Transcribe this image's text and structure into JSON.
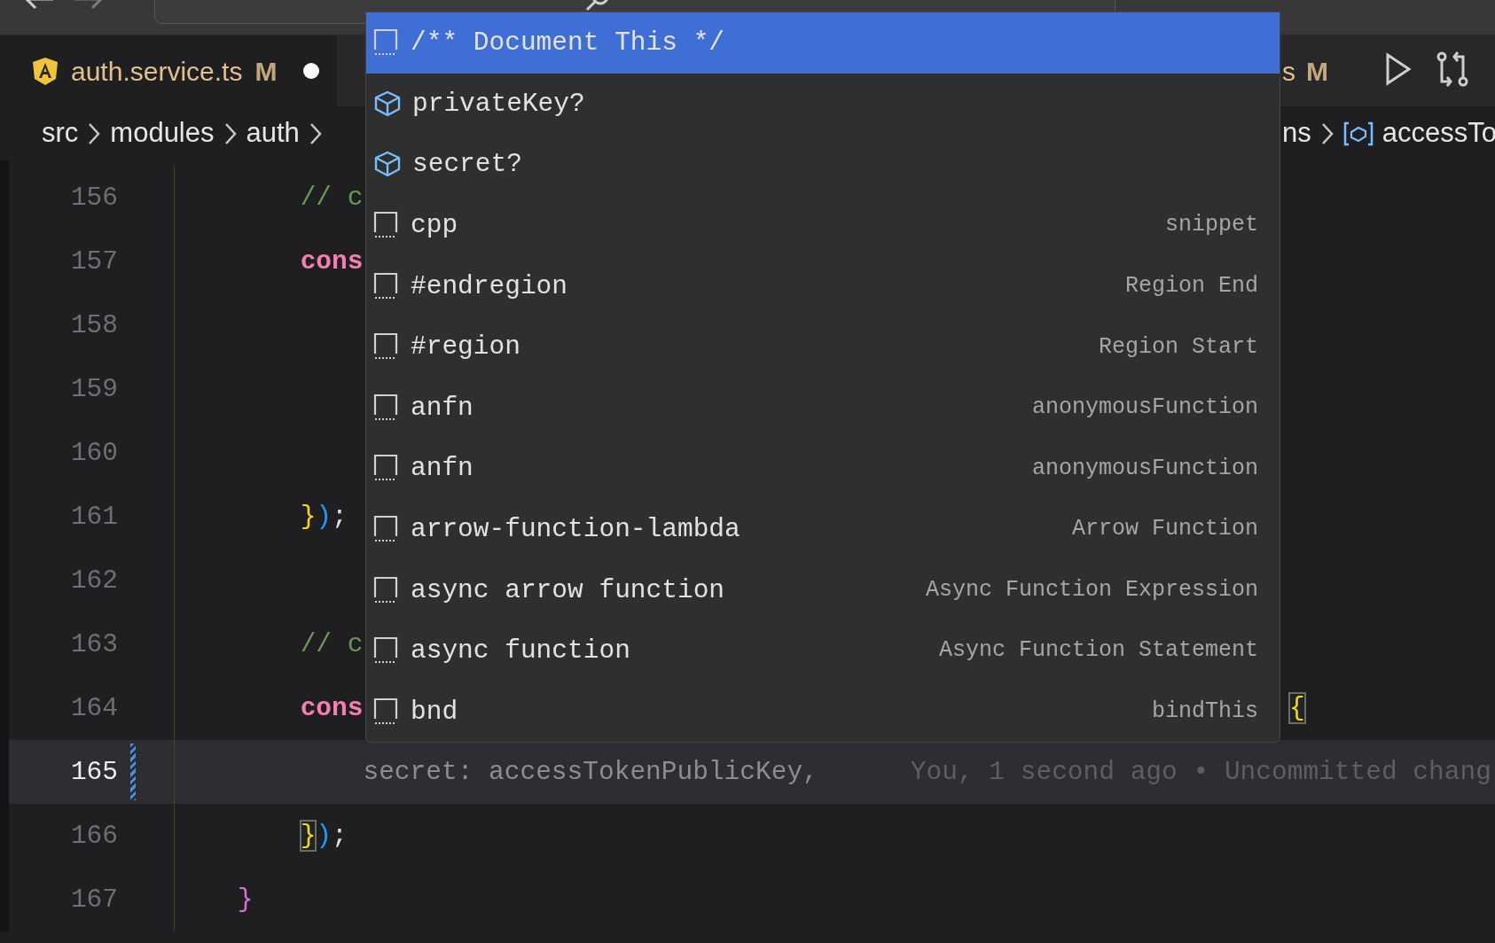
{
  "tabs": [
    {
      "kind": "angular",
      "filename": "auth.service.ts",
      "status": "M",
      "dirty": true
    },
    {
      "filename": "s",
      "status": "M",
      "dirty": false
    }
  ],
  "breadcrumbs": [
    {
      "label": "src"
    },
    {
      "label": "modules"
    },
    {
      "label": "auth"
    }
  ],
  "breadcrumbs_tail": [
    {
      "label": "ns"
    },
    {
      "label": "accessTo",
      "kind": "variable"
    }
  ],
  "editor": {
    "lines": [
      {
        "number": "156",
        "current": false,
        "changed": false,
        "tokens": [
          {
            "text": "        // c",
            "kind": "comment"
          }
        ]
      },
      {
        "number": "157",
        "current": false,
        "changed": false,
        "tokens": [
          {
            "text": "        cons",
            "kind": "keyword"
          }
        ]
      },
      {
        "number": "158",
        "current": false,
        "changed": false
      },
      {
        "number": "159",
        "current": false,
        "changed": false
      },
      {
        "number": "160",
        "current": false,
        "changed": false
      },
      {
        "number": "161",
        "current": false,
        "changed": false,
        "tokens": [
          {
            "text": "        }",
            "kind": "brace1"
          },
          {
            "text": ")",
            "kind": "paren"
          },
          {
            "text": ";",
            "kind": "plain"
          }
        ]
      },
      {
        "number": "162",
        "current": false,
        "changed": false
      },
      {
        "number": "163",
        "current": false,
        "changed": false,
        "tokens": [
          {
            "text": "        // c",
            "kind": "comment"
          }
        ]
      },
      {
        "number": "164",
        "current": false,
        "changed": false,
        "tokens": [
          {
            "text": "        cons",
            "kind": "keyword"
          },
          {
            "text": "                                                           {",
            "kind": "brace1",
            "matched": true
          }
        ]
      },
      {
        "number": "165",
        "current": true,
        "changed": true,
        "tokens": [
          {
            "text": "            secret: accessTokenPublicKey,",
            "kind": "ghost"
          },
          {
            "text": "You, 1 second ago • Uncommitted chang",
            "kind": "blame"
          }
        ]
      },
      {
        "number": "166",
        "current": false,
        "changed": false,
        "tokens": [
          {
            "text": "        }",
            "kind": "brace1",
            "matched": true
          },
          {
            "text": ")",
            "kind": "paren"
          },
          {
            "text": ";",
            "kind": "plain"
          }
        ]
      },
      {
        "number": "167",
        "current": false,
        "changed": false,
        "tokens": [
          {
            "text": "    }",
            "kind": "brace2"
          }
        ]
      }
    ]
  },
  "suggestions": [
    {
      "label": "/** Document This */",
      "kind": "snippet",
      "selected": true
    },
    {
      "label": "privateKey?",
      "kind": "property",
      "selected": false
    },
    {
      "label": "secret?",
      "kind": "property",
      "selected": false
    },
    {
      "label": "cpp",
      "detail": "snippet",
      "kind": "snippet",
      "selected": false
    },
    {
      "label": "#endregion",
      "detail": "Region End",
      "kind": "snippet",
      "selected": false
    },
    {
      "label": "#region",
      "detail": "Region Start",
      "kind": "snippet",
      "selected": false
    },
    {
      "label": "anfn",
      "detail": "anonymousFunction",
      "kind": "snippet",
      "selected": false
    },
    {
      "label": "anfn",
      "detail": "anonymousFunction",
      "kind": "snippet",
      "selected": false
    },
    {
      "label": "arrow-function-lambda",
      "detail": "Arrow Function",
      "kind": "snippet",
      "selected": false
    },
    {
      "label": "async arrow function",
      "detail": "Async Function Expression",
      "kind": "snippet",
      "selected": false
    },
    {
      "label": "async function",
      "detail": "Async Function Statement",
      "kind": "snippet",
      "selected": false
    },
    {
      "label": "bnd",
      "detail": "bindThis",
      "kind": "snippet",
      "selected": false
    }
  ]
}
